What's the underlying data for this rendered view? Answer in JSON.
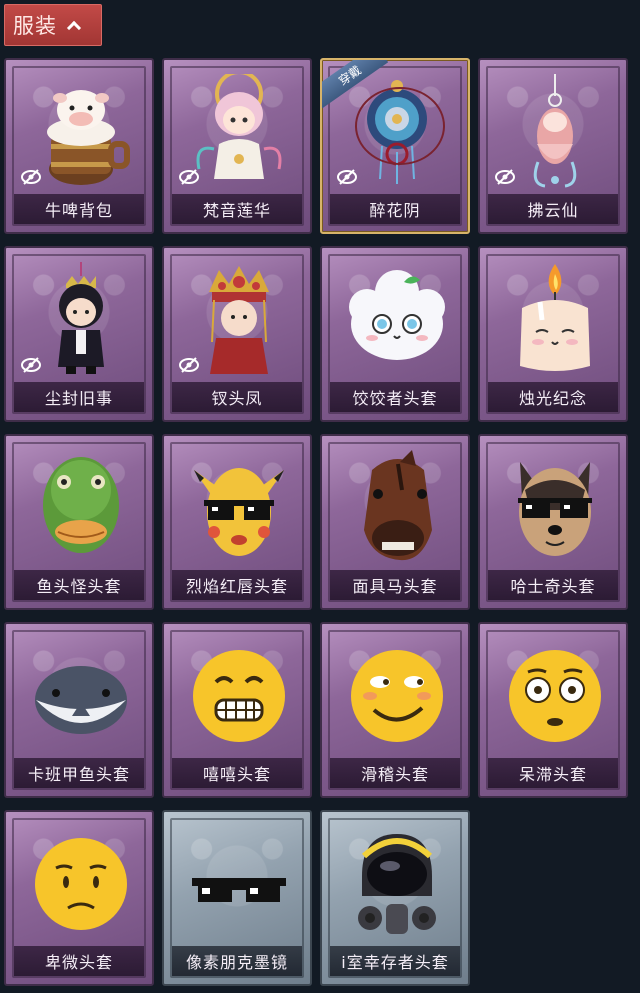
{
  "section": {
    "title": "服装"
  },
  "equipped_badge": "穿戴",
  "items": [
    {
      "name": "牛啤背包",
      "theme": "purple",
      "hidden": true,
      "equipped": false,
      "icon": "cow-beer-backpack-icon"
    },
    {
      "name": "梵音莲华",
      "theme": "purple",
      "hidden": true,
      "equipped": false,
      "icon": "lotus-character-icon"
    },
    {
      "name": "醉花阴",
      "theme": "purple",
      "hidden": true,
      "equipped": true,
      "icon": "flower-charm-icon"
    },
    {
      "name": "拂云仙",
      "theme": "purple",
      "hidden": true,
      "equipped": false,
      "icon": "cloud-fairy-charm-icon"
    },
    {
      "name": "尘封旧事",
      "theme": "purple",
      "hidden": true,
      "equipped": false,
      "icon": "dark-prince-doll-icon"
    },
    {
      "name": "钗头凤",
      "theme": "purple",
      "hidden": true,
      "equipped": false,
      "icon": "phoenix-crown-doll-icon"
    },
    {
      "name": "饺饺者头套",
      "theme": "purple",
      "hidden": false,
      "equipped": false,
      "icon": "dumpling-head-icon"
    },
    {
      "name": "烛光纪念",
      "theme": "purple",
      "hidden": false,
      "equipped": false,
      "icon": "candle-head-icon"
    },
    {
      "name": "鱼头怪头套",
      "theme": "purple",
      "hidden": false,
      "equipped": false,
      "icon": "fish-head-icon"
    },
    {
      "name": "烈焰红唇头套",
      "theme": "purple",
      "hidden": false,
      "equipped": false,
      "icon": "yellow-mouse-head-icon"
    },
    {
      "name": "面具马头套",
      "theme": "purple",
      "hidden": false,
      "equipped": false,
      "icon": "horse-mask-icon"
    },
    {
      "name": "哈士奇头套",
      "theme": "purple",
      "hidden": false,
      "equipped": false,
      "icon": "husky-head-icon"
    },
    {
      "name": "卡班甲鱼头套",
      "theme": "purple",
      "hidden": false,
      "equipped": false,
      "icon": "whale-head-icon"
    },
    {
      "name": "嘻嘻头套",
      "theme": "purple",
      "hidden": false,
      "equipped": false,
      "icon": "grin-emoji-head-icon"
    },
    {
      "name": "滑稽头套",
      "theme": "purple",
      "hidden": false,
      "equipped": false,
      "icon": "smirk-emoji-head-icon"
    },
    {
      "name": "呆滞头套",
      "theme": "purple",
      "hidden": false,
      "equipped": false,
      "icon": "stare-emoji-head-icon"
    },
    {
      "name": "卑微头套",
      "theme": "purple",
      "hidden": false,
      "equipped": false,
      "icon": "humble-emoji-head-icon"
    },
    {
      "name": "像素朋克墨镜",
      "theme": "gray",
      "hidden": false,
      "equipped": false,
      "icon": "pixel-sunglasses-icon"
    },
    {
      "name": "i室幸存者头套",
      "theme": "gray",
      "hidden": false,
      "equipped": false,
      "icon": "gas-mask-helmet-icon"
    }
  ],
  "colors": {
    "background": "#121a24",
    "tab": "#b23f3d",
    "card_purple": "#8e679a",
    "card_gray": "#93a2af",
    "equipped_border": "#d7b46a"
  }
}
